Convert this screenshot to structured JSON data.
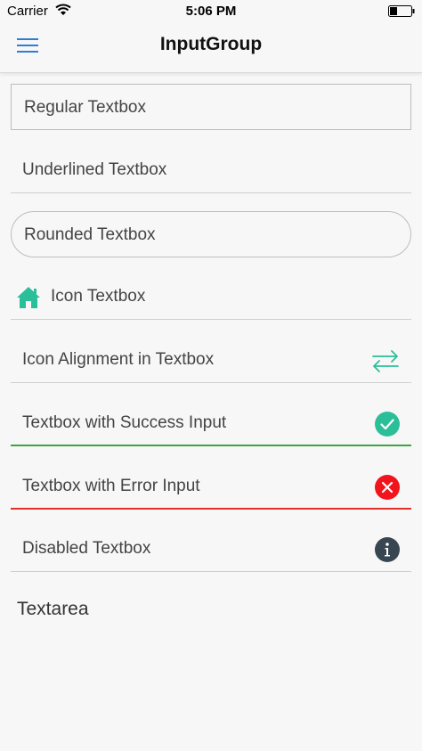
{
  "status_bar": {
    "carrier": "Carrier",
    "time": "5:06 PM"
  },
  "nav": {
    "title": "InputGroup",
    "menu_icon": "hamburger-icon"
  },
  "fields": {
    "regular": "Regular Textbox",
    "underlined": "Underlined Textbox",
    "rounded": "Rounded Textbox",
    "icon": "Icon Textbox",
    "icon_alignment": "Icon Alignment in Textbox",
    "success": "Textbox with Success Input",
    "error": "Textbox with Error Input",
    "disabled": "Disabled Textbox",
    "textarea": "Textarea"
  },
  "icons": {
    "icon_textbox": "home-icon",
    "icon_alignment": "swap-arrows-icon",
    "success": "checkmark-circle-icon",
    "error": "close-circle-icon",
    "disabled": "info-circle-icon"
  },
  "colors": {
    "accent_blue": "#2e7fd4",
    "teal": "#2bbf99",
    "success_green": "#3fa43f",
    "error_red": "#e0302a",
    "info_dark": "#374650"
  }
}
